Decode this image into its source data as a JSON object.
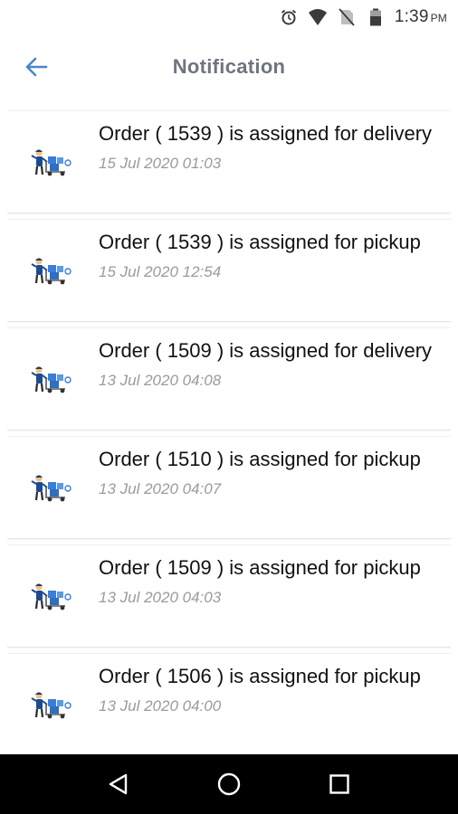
{
  "status_bar": {
    "time": "1:39",
    "ampm": "PM",
    "icons": [
      "alarm-icon",
      "wifi-icon",
      "no-sim-icon",
      "battery-icon"
    ]
  },
  "header": {
    "title": "Notification",
    "back_icon": "back-arrow-icon"
  },
  "colors": {
    "accent": "#4a86c5",
    "title": "#6f7480",
    "timestamp": "#9b9b9b"
  },
  "notifications": [
    {
      "message": "Order ( 1539 ) is assigned for delivery",
      "time": "15 Jul 2020 01:03",
      "icon": "delivery-man-icon"
    },
    {
      "message": "Order ( 1539 ) is assigned for pickup",
      "time": "15 Jul 2020 12:54",
      "icon": "delivery-man-icon"
    },
    {
      "message": "Order ( 1509 ) is assigned for delivery",
      "time": "13 Jul 2020 04:08",
      "icon": "delivery-man-icon"
    },
    {
      "message": "Order ( 1510 ) is assigned for pickup",
      "time": "13 Jul 2020 04:07",
      "icon": "delivery-man-icon"
    },
    {
      "message": "Order ( 1509 ) is assigned for pickup",
      "time": "13 Jul 2020 04:03",
      "icon": "delivery-man-icon"
    },
    {
      "message": "Order ( 1506 ) is assigned for pickup",
      "time": "13 Jul 2020 04:00",
      "icon": "delivery-man-icon"
    }
  ],
  "nav_bar": {
    "buttons": [
      "back-triangle-icon",
      "home-circle-icon",
      "recents-square-icon"
    ]
  }
}
